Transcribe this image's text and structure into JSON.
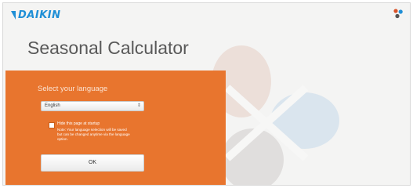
{
  "brand": {
    "name": "DAIKIN"
  },
  "header": {
    "title": "Seasonal Calculator",
    "corner_icon": "daikin-flower-icon"
  },
  "language_panel": {
    "heading": "Select your language",
    "selected_language": "English",
    "hide_checkbox_label": "Hide this page at startup",
    "checked": false,
    "note": "Note: Your language selection will be saved but can be changed anytime via the language option.",
    "ok_label": "OK"
  },
  "colors": {
    "brand_blue": "#1f8fd6",
    "panel_orange": "#e8752e",
    "petal_red": "#e8b49a",
    "petal_blue": "#bcd6e8",
    "petal_gray": "#d2d2d0",
    "title_gray": "#595959"
  }
}
